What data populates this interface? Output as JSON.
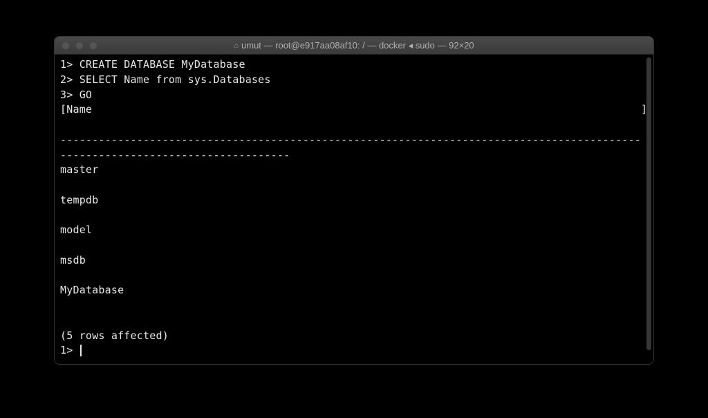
{
  "window": {
    "title": "umut — root@e917aa08af10: / — docker ◂ sudo — 92×20"
  },
  "terminal": {
    "lines": {
      "l1": "1> CREATE DATABASE MyDatabase",
      "l2": "2> SELECT Name from sys.Databases",
      "l3": "3> GO",
      "l4": "[Name                                                                                      ]",
      "l5": "",
      "l6": "-------------------------------------------------------------------------------------------",
      "l7": "------------------------------------",
      "r1": "master",
      "r1b": "",
      "r2": "tempdb",
      "r2b": "",
      "r3": "model",
      "r3b": "",
      "r4": "msdb",
      "r4b": "",
      "r5": "MyDatabase",
      "r5b": "",
      "blank": "",
      "footer": "(5 rows affected)",
      "prompt": "1> "
    }
  }
}
